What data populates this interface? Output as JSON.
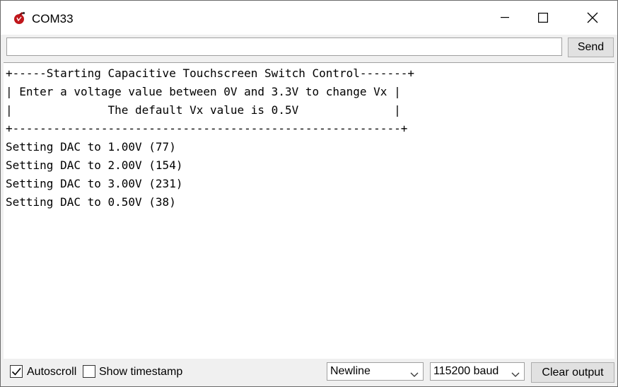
{
  "window": {
    "title": "COM33"
  },
  "input": {
    "value": "",
    "send_label": "Send"
  },
  "output": {
    "lines": [
      "+-----Starting Capacitive Touchscreen Switch Control-------+",
      "| Enter a voltage value between 0V and 3.3V to change Vx |",
      "|              The default Vx value is 0.5V              |",
      "+---------------------------------------------------------+",
      "Setting DAC to 1.00V (77)",
      "Setting DAC to 2.00V (154)",
      "Setting DAC to 3.00V (231)",
      "Setting DAC to 0.50V (38)"
    ]
  },
  "bottom": {
    "autoscroll": {
      "label": "Autoscroll",
      "checked": true
    },
    "timestamp": {
      "label": "Show timestamp",
      "checked": false
    },
    "line_ending": "Newline",
    "baud": "115200 baud",
    "clear_label": "Clear output"
  },
  "icons": {
    "app": "arduino-serial-icon",
    "minimize": "minimize-icon",
    "maximize": "maximize-icon",
    "close": "close-icon",
    "checkmark": "checkmark-icon",
    "dropdown": "chevron-down-icon"
  }
}
